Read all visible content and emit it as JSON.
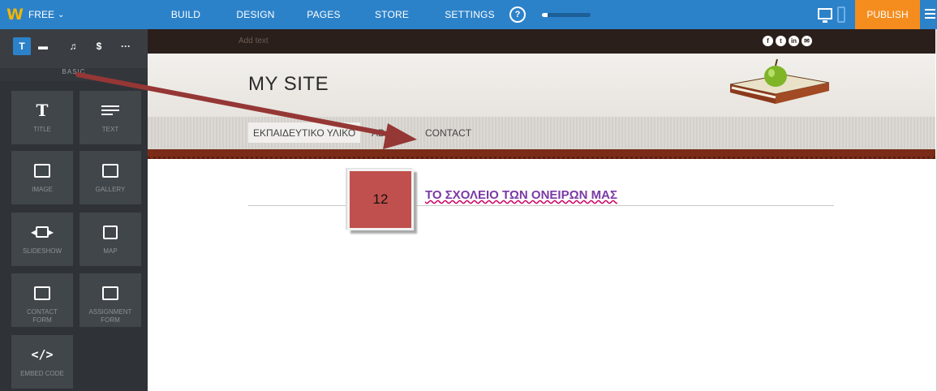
{
  "topbar": {
    "brand_label": "FREE",
    "nav": [
      "BUILD",
      "DESIGN",
      "PAGES",
      "STORE",
      "SETTINGS"
    ],
    "help_label": "?",
    "progress_fraction": 0.12,
    "publish_label": "PUBLISH"
  },
  "sidebar": {
    "section_label": "BASIC",
    "tools": [
      "T",
      "▬",
      "♫",
      "$",
      "···"
    ],
    "tiles": [
      {
        "label": "TITLE",
        "icon": "title-icon"
      },
      {
        "label": "TEXT",
        "icon": "text-icon"
      },
      {
        "label": "IMAGE",
        "icon": "image-icon"
      },
      {
        "label": "GALLERY",
        "icon": "gallery-icon"
      },
      {
        "label": "SLIDESHOW",
        "icon": "slideshow-icon"
      },
      {
        "label": "MAP",
        "icon": "map-icon"
      },
      {
        "label": "CONTACT\nFORM",
        "icon": "form-icon"
      },
      {
        "label": "ASSIGNMENT\nFORM",
        "icon": "form-icon"
      },
      {
        "label": "EMBED CODE",
        "icon": "code-icon"
      }
    ]
  },
  "site": {
    "add_text": "Add text",
    "socials": [
      "f",
      "t",
      "in",
      "✉"
    ],
    "title": "MY SITE",
    "nav": [
      "ΕΚΠΑΙΔΕΥΤΙΚΟ ΥΛΙΚΟ",
      "AB",
      "CONTACT"
    ],
    "content_title": "ΤΟ ΣΧΟΛΕΙΟ ΤΩΝ ΟΝΕΙΡΩΝ ΜΑΣ"
  },
  "annotation": {
    "badge": "12",
    "arrow_color": "#953735",
    "badge_color": "#c0504d"
  }
}
